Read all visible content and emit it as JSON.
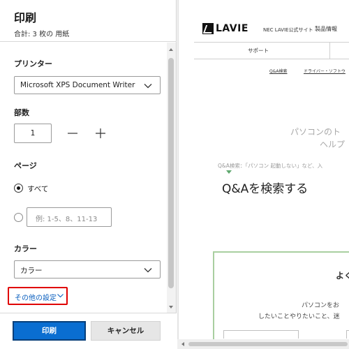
{
  "print_panel": {
    "title": "印刷",
    "summary": "合計: 3 枚の 用紙",
    "printer": {
      "label": "プリンター",
      "selected": "Microsoft XPS Document Writer"
    },
    "copies": {
      "label": "部数",
      "value": "1",
      "decrement_icon": "minus-icon",
      "increment_icon": "plus-icon"
    },
    "pages": {
      "label": "ページ",
      "option_all": "すべて",
      "range_placeholder": "例: 1-5、8、11-13",
      "selected": "all"
    },
    "color": {
      "label": "カラー",
      "selected": "カラー"
    },
    "more_settings": "その他の設定",
    "print_button": "印刷",
    "cancel_button": "キャンセル"
  },
  "preview": {
    "logo": "LAVIE",
    "logo_sub": "NEC LAVIE公式サイト",
    "nav_products": "製品情報",
    "nav_support": "サポート",
    "sub_links": [
      "Q&A検索",
      "ドライバー・ソフトウ"
    ],
    "hero_line1": "パソコンのト",
    "hero_line2": "ヘルプ",
    "qa_hint": "Q&A検索：「パソコン 起動しない」など、入",
    "qa_title": "Q&Aを検索する",
    "faq_heading": "よく",
    "faq_line1": "パソコンをお",
    "faq_line2": "したいことやりたいこと、迷"
  },
  "colors": {
    "primary": "#0a6ed1",
    "highlight": "#e00000",
    "link": "#0a5fbf",
    "green": "#5fa86e"
  }
}
